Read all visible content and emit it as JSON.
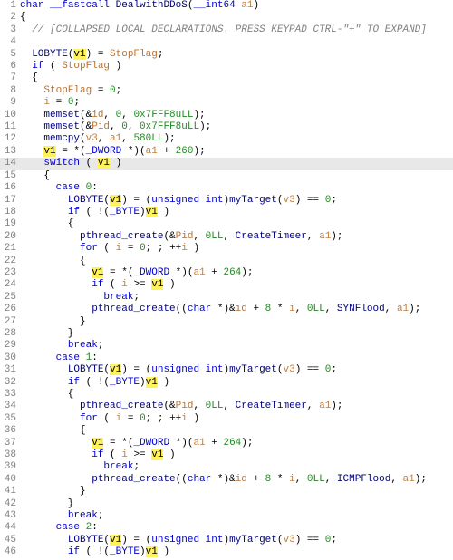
{
  "signature": {
    "ret": "char",
    "cc": "__fastcall",
    "name": "DealwithDDoS",
    "arg_type": "__int64",
    "arg_name": "a1"
  },
  "comment_collapsed": "// [COLLAPSED LOCAL DECLARATIONS. PRESS KEYPAD CTRL-\"+\" TO EXPAND]",
  "idents": {
    "v1": "v1",
    "a1": "a1",
    "v3": "v3",
    "i": "i",
    "id": "id",
    "Pid": "Pid",
    "StopFlag": "StopFlag",
    "LOBYTE": "LOBYTE",
    "BYTE": "_BYTE",
    "myTarget": "myTarget",
    "memset": "memset",
    "memcpy": "memcpy",
    "pthread_create": "pthread_create",
    "CreateTimeer": "CreateTimeer",
    "SYNFlood": "SYNFlood",
    "ICMPFlood": "ICMPFlood",
    "DWORD": "_DWORD",
    "unsigned_int": "unsigned int",
    "char": "char"
  },
  "nums": {
    "zero": "0",
    "hex7fff8": "0x7FFF8uLL",
    "n580": "580LL",
    "n260": "260",
    "n264": "264",
    "zeroLL": "0LL",
    "eight": "8"
  },
  "kw": {
    "if": "if",
    "for": "for",
    "switch": "switch",
    "case": "case",
    "break": "break"
  },
  "cases": {
    "c0": "0",
    "c1": "1",
    "c2": "2"
  }
}
